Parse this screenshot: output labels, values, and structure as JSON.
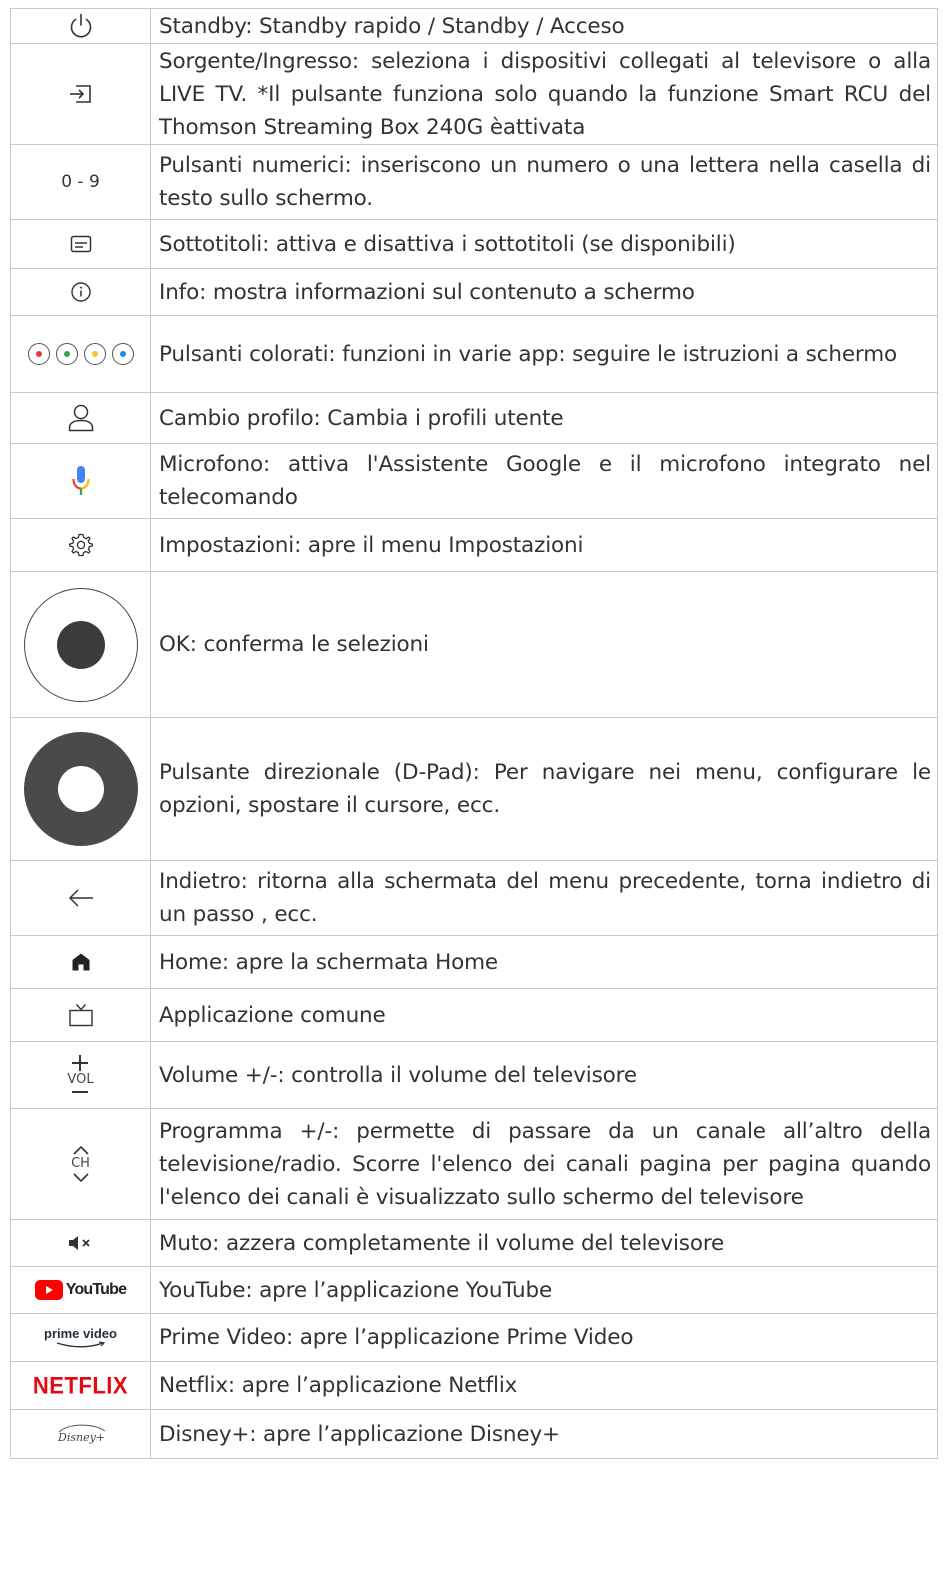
{
  "rows": [
    {
      "icon": "power-icon",
      "text": "Standby: Standby rapido / Standby / Acceso"
    },
    {
      "icon": "input-source-icon",
      "text": "Sorgente/Ingresso: seleziona i dispositivi collegati al televisore o alla LIVE TV. *Il pulsante funziona solo quando la funzione Smart RCU del Thomson Streaming Box 240G èattivata"
    },
    {
      "icon": "digits-label",
      "label": "0 - 9",
      "text": "Pulsanti numerici: inseriscono un numero o una lettera nella casella di testo sullo schermo."
    },
    {
      "icon": "subtitles-icon",
      "text": "Sottotitoli: attiva e disattiva i sottotitoli (se disponibili)"
    },
    {
      "icon": "info-icon",
      "text": "Info: mostra informazioni sul contenuto a schermo"
    },
    {
      "icon": "color-buttons-icon",
      "text": "Pulsanti colorati: funzioni in varie app: seguire le istruzioni a schermo"
    },
    {
      "icon": "profile-icon",
      "text": "Cambio profilo: Cambia i profili utente"
    },
    {
      "icon": "microphone-icon",
      "text": "Microfono: attiva l'Assistente Google e il microfono integrato nel telecomando"
    },
    {
      "icon": "gear-icon",
      "text": "Impostazioni: apre il menu Impostazioni"
    },
    {
      "icon": "ok-button-icon",
      "text": "OK: conferma le selezioni"
    },
    {
      "icon": "dpad-icon",
      "text": "Pulsante direzionale (D-Pad): Per navigare nei menu, configurare le opzioni, spostare il cursore, ecc."
    },
    {
      "icon": "back-arrow-icon",
      "text": "Indietro: ritorna alla schermata del menu precedente, torna indietro di un passo , ecc."
    },
    {
      "icon": "home-icon",
      "text": "Home: apre la schermata Home"
    },
    {
      "icon": "tv-icon",
      "text": "Applicazione comune"
    },
    {
      "icon": "volume-icon",
      "label": "VOL",
      "text": "Volume +/-: controlla il volume del televisore"
    },
    {
      "icon": "channel-icon",
      "label": "CH",
      "text": "Programma +/-: permette di passare da un canale all’altro della televisione/radio. Scorre l'elenco dei canali pagina per pagina quando l'elenco dei canali è visualizzato sullo schermo del televisore"
    },
    {
      "icon": "mute-icon",
      "text": "Muto: azzera completamente il volume del televisore"
    },
    {
      "icon": "youtube-logo",
      "label": "YouTube",
      "text": "YouTube: apre l’applicazione YouTube"
    },
    {
      "icon": "prime-video-logo",
      "label": "prime video",
      "text": "Prime Video: apre l’applicazione Prime Video"
    },
    {
      "icon": "netflix-logo",
      "label": "NETFLIX",
      "text": "Netflix: apre l’applicazione Netflix"
    },
    {
      "icon": "disney-plus-logo",
      "label": "Disney+",
      "text": "Disney+: apre l’applicazione Disney+"
    }
  ],
  "colors": {
    "red": "#e53935",
    "green": "#43a047",
    "yellow": "#fbc02d",
    "blue": "#1e88e5",
    "youtube": "#ff0000",
    "netflix": "#e50914"
  }
}
